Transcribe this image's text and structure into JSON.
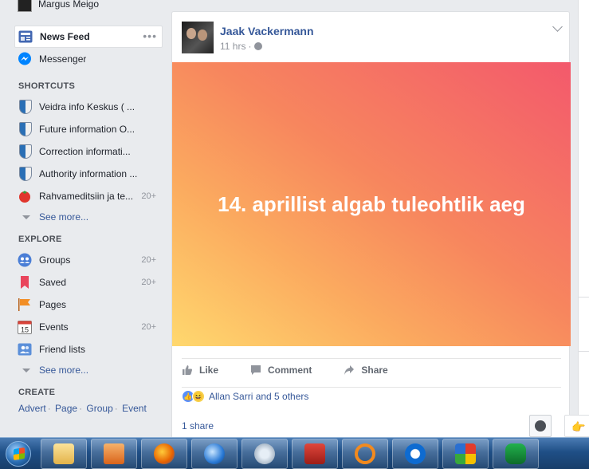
{
  "profile": {
    "name": "Margus Meigo"
  },
  "nav": {
    "news_feed": "News Feed",
    "messenger": "Messenger"
  },
  "shortcuts": {
    "heading": "SHORTCUTS",
    "items": [
      {
        "label": "Veidra info Keskus ( ...",
        "icon": "shield-icon",
        "count": ""
      },
      {
        "label": "Future information O...",
        "icon": "shield-icon",
        "count": ""
      },
      {
        "label": "Correction informati...",
        "icon": "shield-icon",
        "count": ""
      },
      {
        "label": "Authority information ...",
        "icon": "shield-icon",
        "count": ""
      },
      {
        "label": "Rahvameditsiin ja te...",
        "icon": "tomato-icon",
        "count": "20+"
      }
    ],
    "see_more": "See more..."
  },
  "explore": {
    "heading": "EXPLORE",
    "items": [
      {
        "label": "Groups",
        "icon": "groups-icon",
        "count": "20+"
      },
      {
        "label": "Saved",
        "icon": "bookmark-icon",
        "count": "20+"
      },
      {
        "label": "Pages",
        "icon": "flag-icon",
        "count": ""
      },
      {
        "label": "Events",
        "icon": "calendar-icon",
        "count": "20+",
        "calendar_day": "15"
      },
      {
        "label": "Friend lists",
        "icon": "friends-icon",
        "count": ""
      }
    ],
    "see_more": "See more..."
  },
  "create": {
    "heading": "CREATE",
    "links": [
      "Advert",
      "Page",
      "Group",
      "Event"
    ]
  },
  "post": {
    "author": "Jaak Vackermann",
    "time": "11 hrs",
    "body_text": "14. aprillist algab tuleohtlik aeg",
    "actions": {
      "like": "Like",
      "comment": "Comment",
      "share": "Share"
    },
    "reactions_text": "Allan Sarri and 5 others",
    "shares": "1 share"
  },
  "colors": {
    "link": "#365899",
    "background": "#e9ebee",
    "gradient_start": "#ffd86e",
    "gradient_end": "#f3596c"
  },
  "taskbar": {
    "apps": [
      "file-explorer-icon",
      "media-player-icon",
      "firefox-icon",
      "browser-icon",
      "network-icon",
      "toolbox-icon",
      "search-tool-icon",
      "teamviewer-icon",
      "avg-icon",
      "malwarebytes-icon"
    ]
  }
}
